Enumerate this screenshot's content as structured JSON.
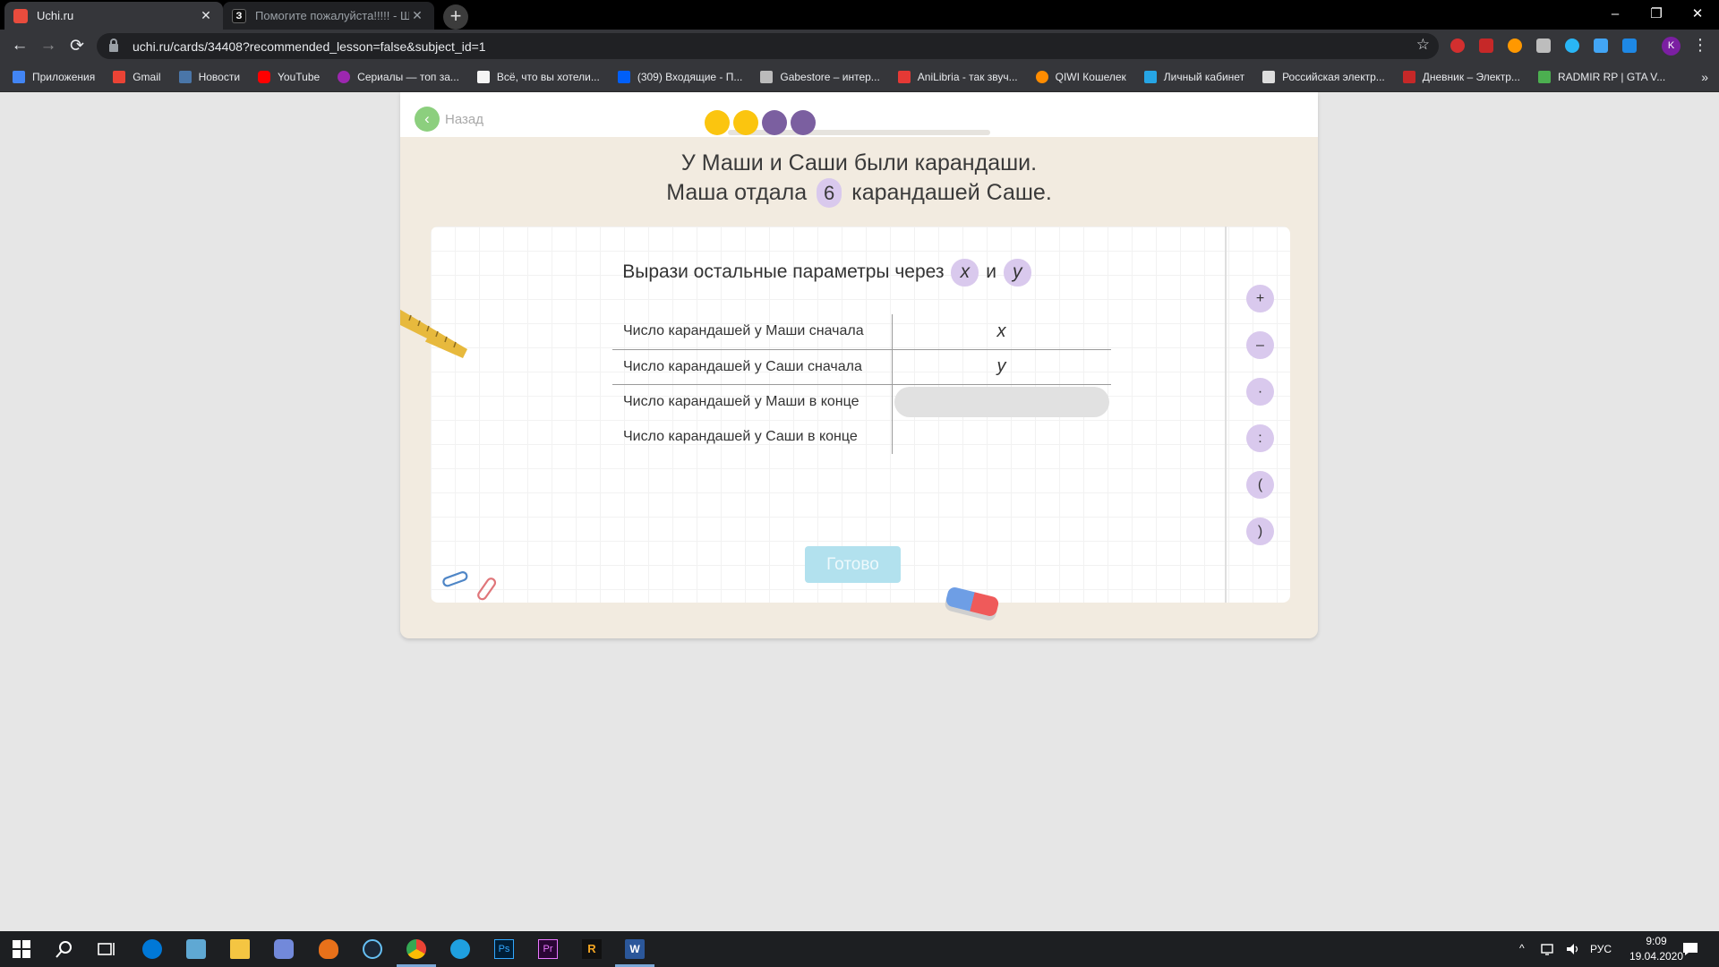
{
  "browser": {
    "tabs": [
      {
        "title": "Uchi.ru",
        "active": true,
        "favicon_color": "#e84c3d"
      },
      {
        "title": "Помогите пожалуйста!!!!! - Шко",
        "active": false,
        "favicon_letter": "З",
        "favicon_color": "#111111"
      }
    ],
    "new_tab": "+",
    "url": "uchi.ru/cards/34408?recommended_lesson=false&subject_id=1",
    "controls": {
      "minimize": "–",
      "maximize": "❐",
      "close": "✕"
    },
    "nav": {
      "back": "←",
      "forward": "→",
      "reload": "⟳"
    },
    "profile_initial": "K",
    "bookmarks": [
      {
        "label": "Приложения",
        "icon_color": "#4285f4"
      },
      {
        "label": "Gmail",
        "icon_color": "#ea4335"
      },
      {
        "label": "Новости",
        "icon_color": "#4a76a8"
      },
      {
        "label": "YouTube",
        "icon_color": "#ff0000"
      },
      {
        "label": "Сериалы — топ за...",
        "icon_color": "#9c27b0"
      },
      {
        "label": "Всё, что вы хотели...",
        "icon_color": "#f5f5f5"
      },
      {
        "label": "(309) Входящие - П...",
        "icon_color": "#005ff9"
      },
      {
        "label": "Gabestore – интер...",
        "icon_color": "#bbbbbb"
      },
      {
        "label": "AniLibria - так звуч...",
        "icon_color": "#e53935"
      },
      {
        "label": "QIWI Кошелек",
        "icon_color": "#ff8c00"
      },
      {
        "label": "Личный кабинет",
        "icon_color": "#26a5e4"
      },
      {
        "label": "Российская электр...",
        "icon_color": "#dddddd"
      },
      {
        "label": "Дневник – Электр...",
        "icon_color": "#c62828"
      },
      {
        "label": "RADMIR RP | GTA V...",
        "icon_color": "#4caf50"
      }
    ],
    "bookmarks_more": "»"
  },
  "page": {
    "back_label": "Назад",
    "progress_dots": [
      "#fbc50f",
      "#fbc50f",
      "#7b5fa0",
      "#7b5fa0"
    ],
    "problem_line1": "У Маши и Саши были карандаши.",
    "problem_line2_before": "Маша отдала",
    "problem_number": "6",
    "problem_line2_after": "карандашей Саше.",
    "instruction_before": "Вырази остальные параметры через",
    "var_x": "x",
    "instruction_and": "и",
    "var_y": "y",
    "rows": [
      {
        "label": "Число карандашей у Маши сначала",
        "value": "x"
      },
      {
        "label": "Число карандашей у Саши сначала",
        "value": "y"
      },
      {
        "label": "Число карандашей у Маши в конце",
        "value": ""
      },
      {
        "label": "Число карандашей у Саши в конце",
        "value": ""
      }
    ],
    "done_label": "Готово",
    "operators": [
      "+",
      "–",
      "·",
      ":",
      "(",
      ")"
    ],
    "colors": {
      "accent_purple": "#d9c9ed",
      "done_button": "#b2e1ee",
      "back_green": "#8ccf7e"
    }
  },
  "taskbar": {
    "language": "РУС",
    "time": "9:09",
    "date": "19.04.2020"
  }
}
